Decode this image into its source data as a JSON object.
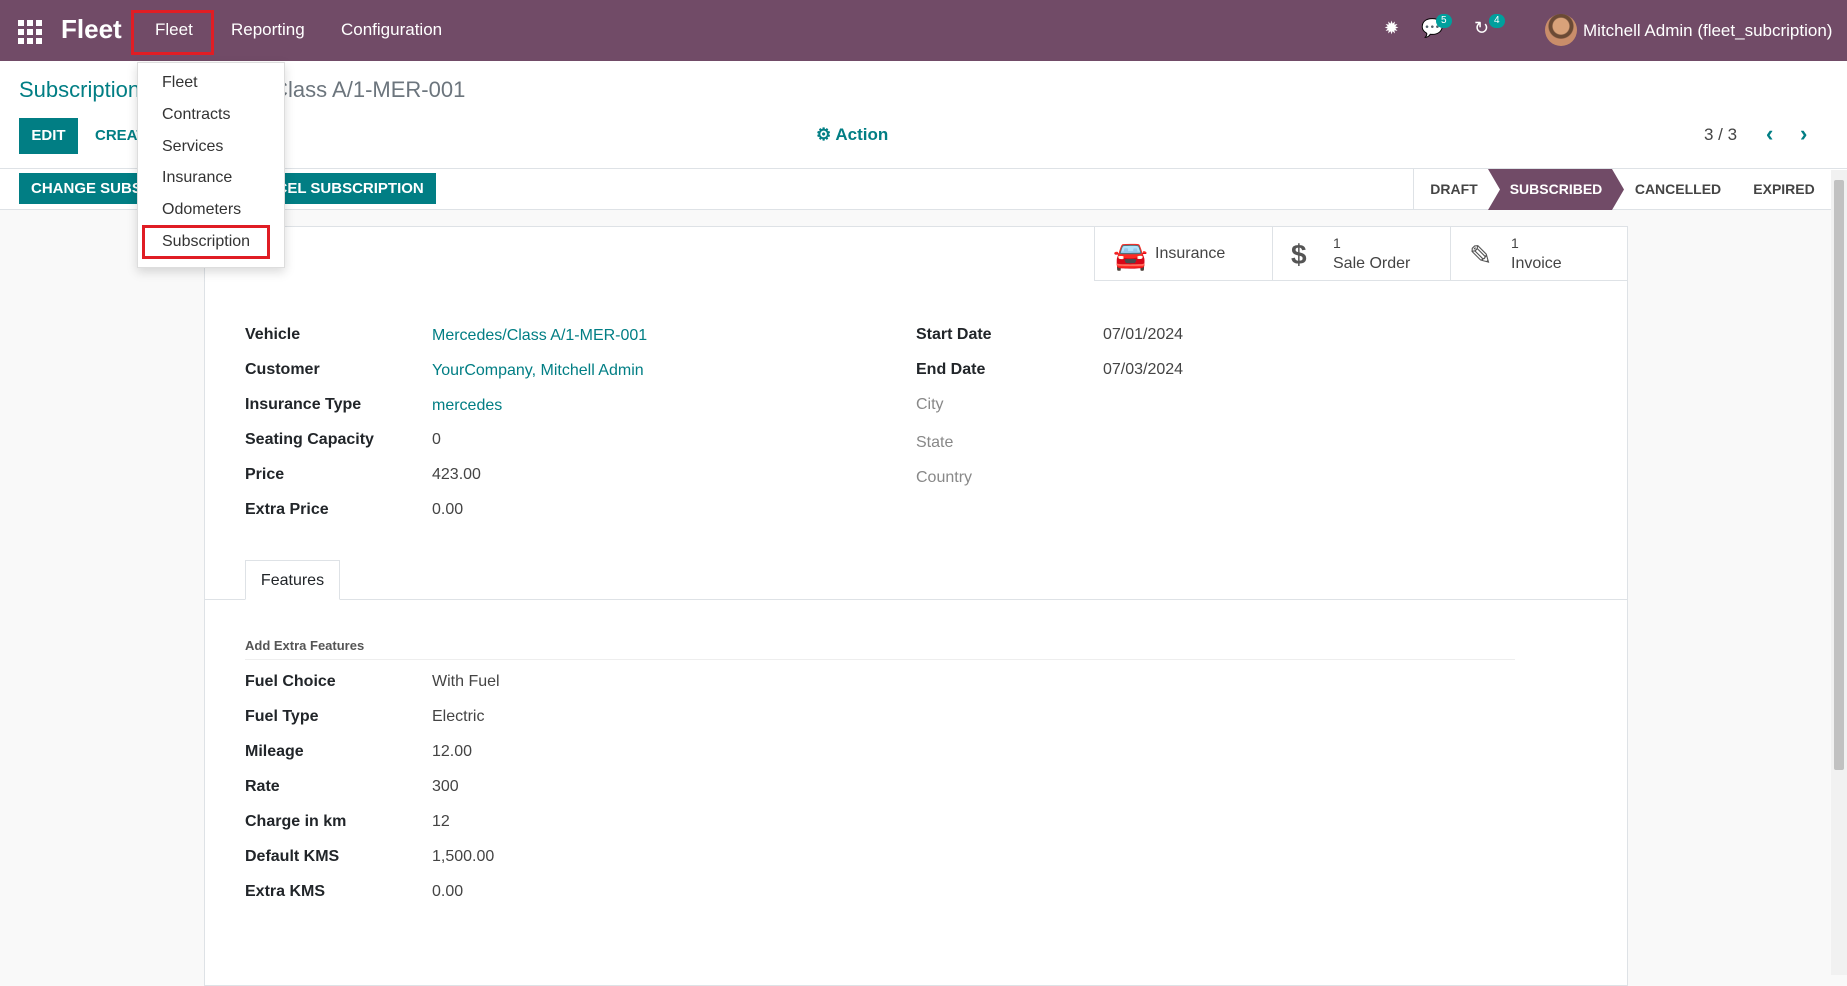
{
  "navbar": {
    "brand": "Fleet",
    "menus": [
      "Fleet",
      "Reporting",
      "Configuration"
    ],
    "chat_count": "5",
    "activity_count": "4",
    "user": "Mitchell Admin (fleet_subcription)"
  },
  "breadcrumb": {
    "parent": "Subscriptions",
    "current": "Mercedes/Class A/1-MER-001"
  },
  "buttons": {
    "edit": "EDIT",
    "create": "CREATE",
    "action": "Action",
    "change_subscription": "CHANGE SUBSCRIPTION",
    "cancel_subscription": "CANCEL SUBSCRIPTION"
  },
  "pager": "3 / 3",
  "stages": [
    "DRAFT",
    "SUBSCRIBED",
    "CANCELLED",
    "EXPIRED"
  ],
  "active_stage": "SUBSCRIBED",
  "smart_buttons": [
    {
      "count": "",
      "label": "Insurance"
    },
    {
      "count": "1",
      "label": "Sale Order"
    },
    {
      "count": "1",
      "label": "Invoice"
    }
  ],
  "left_fields": [
    {
      "label": "Vehicle",
      "value": "Mercedes/Class A/1-MER-001"
    },
    {
      "label": "Customer",
      "value": "YourCompany, Mitchell Admin"
    },
    {
      "label": "Insurance Type",
      "value": "mercedes"
    },
    {
      "label": "Seating Capacity",
      "value": "0"
    },
    {
      "label": "Price",
      "value": "423.00"
    },
    {
      "label": "Extra Price",
      "value": "0.00"
    }
  ],
  "right_fields": [
    {
      "label": "Start Date",
      "value": "07/01/2024"
    },
    {
      "label": "End Date",
      "value": "07/03/2024"
    }
  ],
  "address_placeholders": [
    "City",
    "State",
    "Country"
  ],
  "tab": "Features",
  "features": {
    "title": "Add Extra Features",
    "rows": [
      {
        "label": "Fuel Choice",
        "value": "With Fuel"
      },
      {
        "label": "Fuel Type",
        "value": "Electric"
      },
      {
        "label": "Mileage",
        "value": "12.00"
      },
      {
        "label": "Rate",
        "value": "300"
      },
      {
        "label": "Charge in km",
        "value": "12"
      },
      {
        "label": "Default KMS",
        "value": "1,500.00"
      },
      {
        "label": "Extra KMS",
        "value": "0.00"
      }
    ]
  },
  "dropdown": [
    "Fleet",
    "Contracts",
    "Services",
    "Insurance",
    "Odometers",
    "Subscription"
  ],
  "colors": {
    "brand": "#714b67",
    "accent": "#017e84",
    "highlight": "#e01d24"
  }
}
